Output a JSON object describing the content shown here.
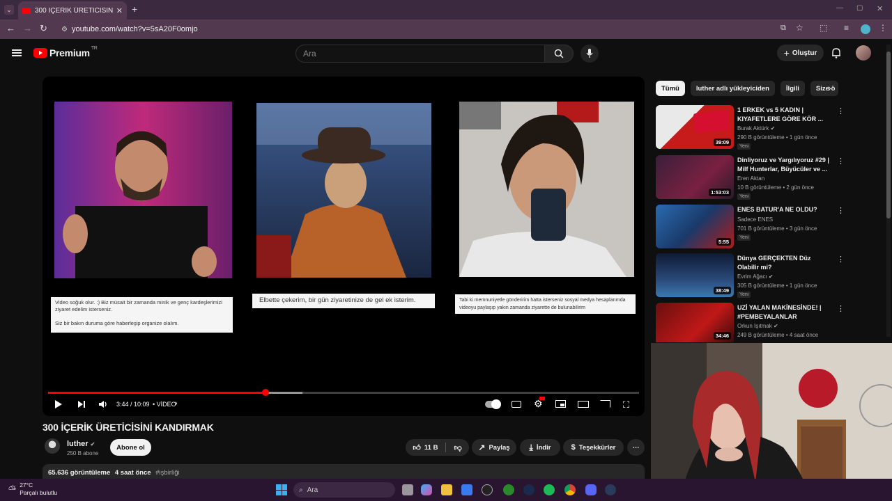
{
  "browser": {
    "tab_title": "300 İÇERİK ÜRETİCİSİNİ KANDIRMAK",
    "url": "youtube.com/watch?v=5sA20F0omjo"
  },
  "header": {
    "logo_text": "Premium",
    "logo_region": "TR",
    "search_placeholder": "Ara",
    "create_label": "Oluştur"
  },
  "player": {
    "captions": [
      "Video soğuk olur. :) Biz müsait bir zamanda minik ve genç kardeşlerimizi ziyaret edelim isterseniz.\n\nSiz bir bakın duruma göre haberleşip organize olalım.",
      "Elbette çekerim, bir gün ziyaretinize de gel ek isterim.",
      "Tabi ki memnuniyetle gönderirim hatta isterseniz sosyal medya hesaplarımda videoyu paylaşıp yakın zamanda ziyarette de bulunabilirim"
    ],
    "time": "3:44 / 10:09",
    "chapter": "• VİDEO",
    "progress": 0.368,
    "buffered": 0.43
  },
  "video": {
    "title": "300 İÇERİK ÜRETİCİSİNİ KANDIRMAK",
    "channel": "luther",
    "subscribers": "250 B abone",
    "subscribe_label": "Abone ol",
    "likes": "11 B",
    "share_label": "Paylaş",
    "download_label": "İndir",
    "thanks_label": "Teşekkürler",
    "views": "65.636 görüntüleme",
    "age": "4 saat önce",
    "hashtag": "#işbirliği"
  },
  "sidebar": {
    "chips": [
      "Tümü",
      "luther adlı yükleyiciden",
      "İlgili",
      "Size ö"
    ],
    "recommendations": [
      {
        "title": "1 ERKEK vs 5 KADIN | KIYAFETLERE GÖRE KÖR ...",
        "channel": "Burak Aktürk",
        "meta": "290 B görüntüleme • 1 gün önce",
        "badge": "Yeni",
        "duration": "39:09"
      },
      {
        "title": "Dinliyoruz ve Yargılıyoruz #29 | Milf Hunterlar, Büyücüler ve ...",
        "channel": "Eren Aktan",
        "meta": "10 B görüntüleme • 2 gün önce",
        "badge": "Yeni",
        "duration": "1:53:03"
      },
      {
        "title": "ENES BATUR'A NE OLDU?",
        "channel": "Sadece ENES",
        "meta": "701 B görüntüleme • 3 gün önce",
        "badge": "Yeni",
        "duration": "5:55"
      },
      {
        "title": "Dünya GERÇEKTEN Düz Olabilir mi?",
        "channel": "Evrim Ağacı",
        "meta": "305 B görüntüleme • 1 gün önce",
        "badge": "Yeni",
        "duration": "38:49"
      },
      {
        "title": "UZİ YALAN MAKİNESİNDE! | #PEMBEYALANLAR",
        "channel": "Orkun Işıtmak",
        "meta": "249 B görüntüleme • 4 saat önce",
        "badge": "",
        "duration": "34:46"
      }
    ]
  },
  "taskbar": {
    "temperature": "27°C",
    "weather": "Parçalı bulutlu",
    "search_label": "Ara"
  }
}
